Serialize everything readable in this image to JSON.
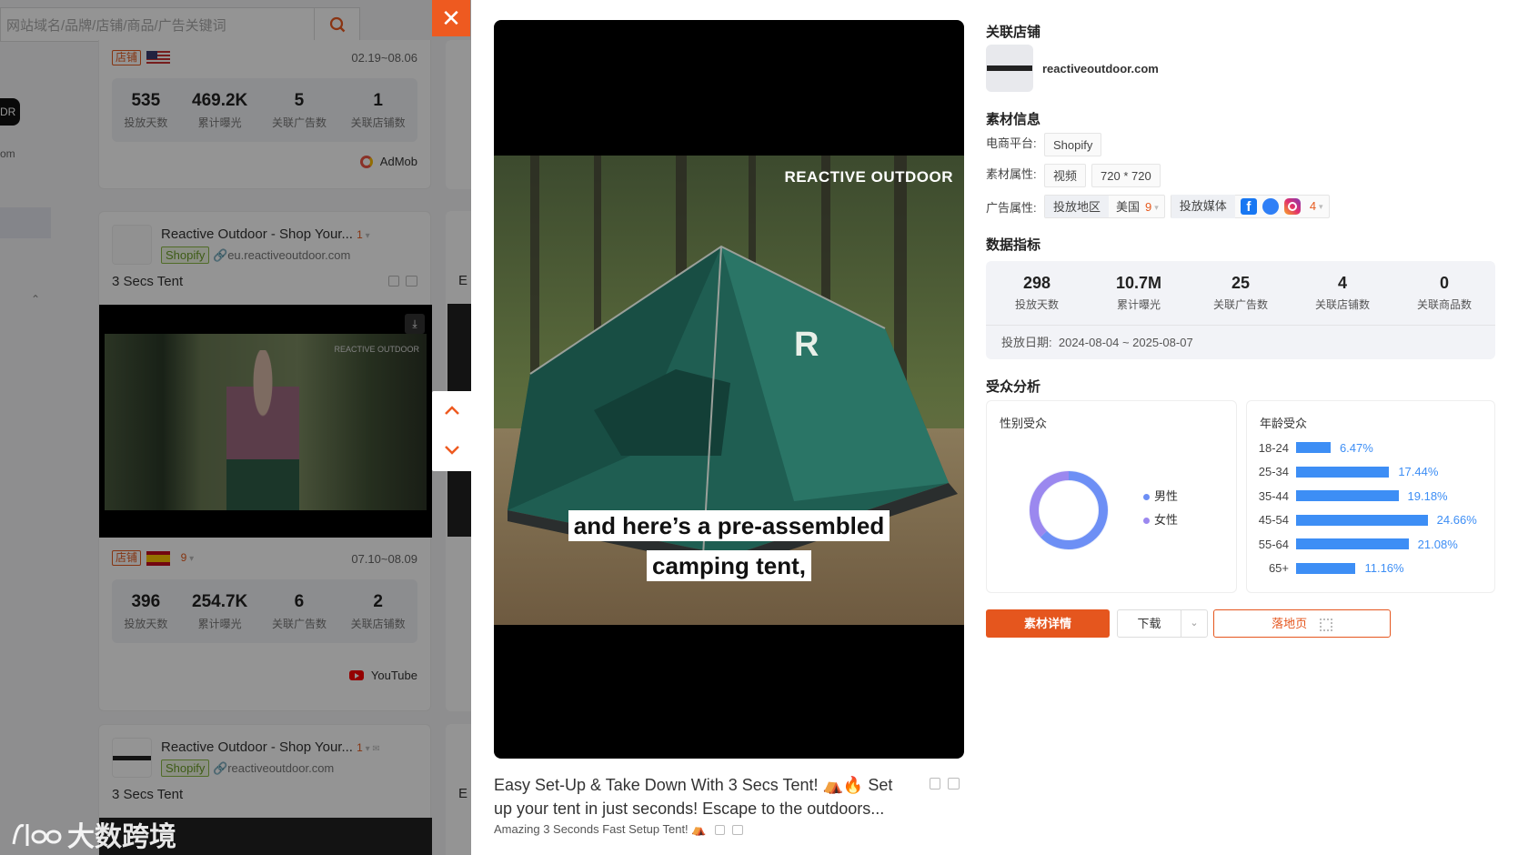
{
  "search": {
    "placeholder": "网站域名/品牌/店铺/商品/广告关键词"
  },
  "cards": [
    {
      "tag": "店铺",
      "date": "02.19~08.06",
      "stats": [
        {
          "n": "535",
          "l": "投放天数"
        },
        {
          "n": "469.2K",
          "l": "累计曝光"
        },
        {
          "n": "5",
          "l": "关联广告数"
        },
        {
          "n": "1",
          "l": "关联店铺数"
        }
      ],
      "network": "AdMob"
    },
    {
      "title": "Reactive Outdoor - Shop Your...",
      "count": "1",
      "platform": "Shopify",
      "domain": "eu.reactiveoutdoor.com",
      "ad_title": "3 Secs Tent",
      "tag": "店铺",
      "extra": "9",
      "date": "07.10~08.09",
      "stats": [
        {
          "n": "396",
          "l": "投放天数"
        },
        {
          "n": "254.7K",
          "l": "累计曝光"
        },
        {
          "n": "6",
          "l": "关联广告数"
        },
        {
          "n": "2",
          "l": "关联店铺数"
        }
      ],
      "network": "YouTube"
    },
    {
      "title": "Reactive Outdoor - Shop Your...",
      "count": "1",
      "platform": "Shopify",
      "domain": "reactiveoutdoor.com",
      "ad_title": "3 Secs Tent"
    }
  ],
  "left_fragments": {
    "om": "om",
    "E": "E"
  },
  "video": {
    "overlay_brand": "REACTIVE OUTDOOR",
    "subtitle_line1": "and here’s a pre-assembled",
    "subtitle_line2": "camping tent,",
    "caption": "Easy Set-Up & Take Down With 3 Secs Tent! ⛺🔥 Set up your tent in just seconds! Escape to the outdoors...",
    "sub_caption": "Amazing 3 Seconds Fast Setup Tent! ⛺"
  },
  "shop": {
    "heading": "关联店铺",
    "domain": "reactiveoutdoor.com"
  },
  "material": {
    "heading": "素材信息",
    "platform_label": "电商平台:",
    "platform": "Shopify",
    "attr_label": "素材属性:",
    "type": "视频",
    "size": "720 * 720",
    "ad_label": "广告属性:",
    "region_label": "投放地区",
    "region": "美国",
    "region_more": "9",
    "media_label": "投放媒体",
    "media_more": "4"
  },
  "metrics": {
    "heading": "数据指标",
    "items": [
      {
        "n": "298",
        "l": "投放天数"
      },
      {
        "n": "10.7M",
        "l": "累计曝光"
      },
      {
        "n": "25",
        "l": "关联广告数"
      },
      {
        "n": "4",
        "l": "关联店铺数"
      },
      {
        "n": "0",
        "l": "关联商品数"
      }
    ],
    "date_label": "投放日期:",
    "date": "2024-08-04 ~ 2025-08-07"
  },
  "audience": {
    "heading": "受众分析",
    "gender_title": "性别受众",
    "male": "男性",
    "female": "女性",
    "age_title": "年龄受众",
    "ages": [
      {
        "range": "18-24",
        "pct": "6.47%",
        "value": 6.47
      },
      {
        "range": "25-34",
        "pct": "17.44%",
        "value": 17.44
      },
      {
        "range": "35-44",
        "pct": "19.18%",
        "value": 19.18
      },
      {
        "range": "45-54",
        "pct": "24.66%",
        "value": 24.66
      },
      {
        "range": "55-64",
        "pct": "21.08%",
        "value": 21.08
      },
      {
        "range": "65+",
        "pct": "11.16%",
        "value": 11.16
      }
    ]
  },
  "actions": {
    "details": "素材详情",
    "download": "下载",
    "landing": "落地页"
  },
  "watermark": "大数跨境",
  "colors": {
    "accent": "#e5561e",
    "bar": "#3d8ef5"
  }
}
